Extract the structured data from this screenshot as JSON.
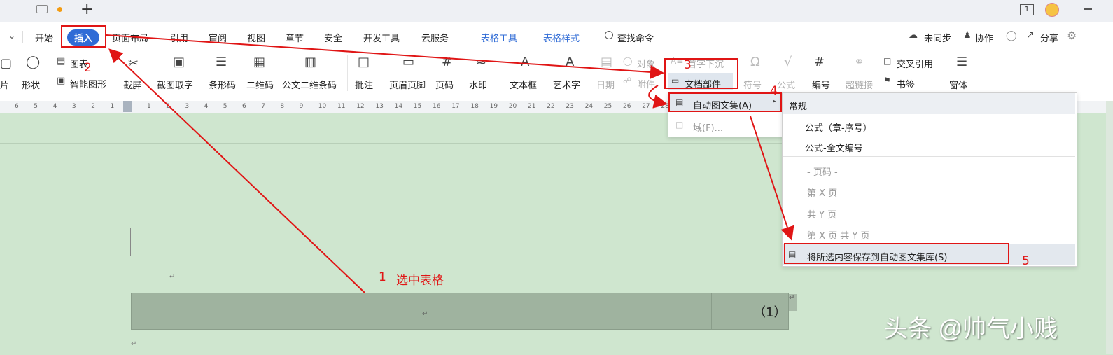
{
  "titlebar": {
    "window_badge": "1",
    "new_tab": "+"
  },
  "tabs": {
    "start": "开始",
    "insert": "插入",
    "layout": "页面布局",
    "reference": "引用",
    "review": "审阅",
    "view": "视图",
    "section": "章节",
    "security": "安全",
    "devtools": "开发工具",
    "cloud": "云服务",
    "table_tools": "表格工具",
    "table_style": "表格样式",
    "find": "查找命令",
    "unsynced": "未同步",
    "collab": "协作",
    "share": "分享"
  },
  "ribbon": {
    "pic": "片",
    "shape": "形状",
    "chart": "图表",
    "smart": "智能图形",
    "screenshot": "截屏",
    "ocr": "截图取字",
    "barcode": "条形码",
    "qrcode": "二维码",
    "doc_qr": "公文二维条码",
    "comment": "批注",
    "header_footer": "页眉页脚",
    "page_num": "页码",
    "watermark": "水印",
    "textbox": "文本框",
    "wordart": "艺术字",
    "date": "日期",
    "object": "对象",
    "attach": "附件",
    "dropcap": "首字下沉",
    "doc_parts": "文档部件",
    "symbol": "符号",
    "formula": "公式",
    "numbering": "编号",
    "hyperlink": "超链接",
    "cross_ref": "交叉引用",
    "bookmark": "书签",
    "form": "窗体"
  },
  "ruler": {
    "left": [
      "6",
      "5",
      "4",
      "3",
      "2",
      "1"
    ],
    "right": [
      "1",
      "2",
      "3",
      "4",
      "5",
      "6",
      "7",
      "8",
      "9",
      "10",
      "11",
      "12",
      "13",
      "14",
      "15",
      "16",
      "17",
      "18",
      "19",
      "20",
      "21",
      "22",
      "23",
      "24",
      "25",
      "26",
      "27",
      "28"
    ]
  },
  "menu1": {
    "autotext": "自动图文集(A)",
    "field": "域(F)..."
  },
  "menu2": {
    "header": "常规",
    "f1": "公式（章-序号）",
    "f2": "公式-全文编号",
    "pg": "- 页码 -",
    "p1": "第 X 页",
    "p2": "共 Y 页",
    "p3": "第 X 页 共 Y 页",
    "save": "将所选内容保存到自动图文集库(S)"
  },
  "annotations": {
    "n1": "1",
    "n1_text": "选中表格",
    "n2": "2",
    "n3": "3",
    "n4": "4",
    "n5": "5"
  },
  "doc": {
    "paren_num": "（1）"
  },
  "watermark": "头条 @帅气小贱",
  "colors": {
    "accent": "#2f6bd6",
    "annotation": "#e01515",
    "doc_bg": "#cfe6cf",
    "table_sel": "#9fb39f"
  }
}
